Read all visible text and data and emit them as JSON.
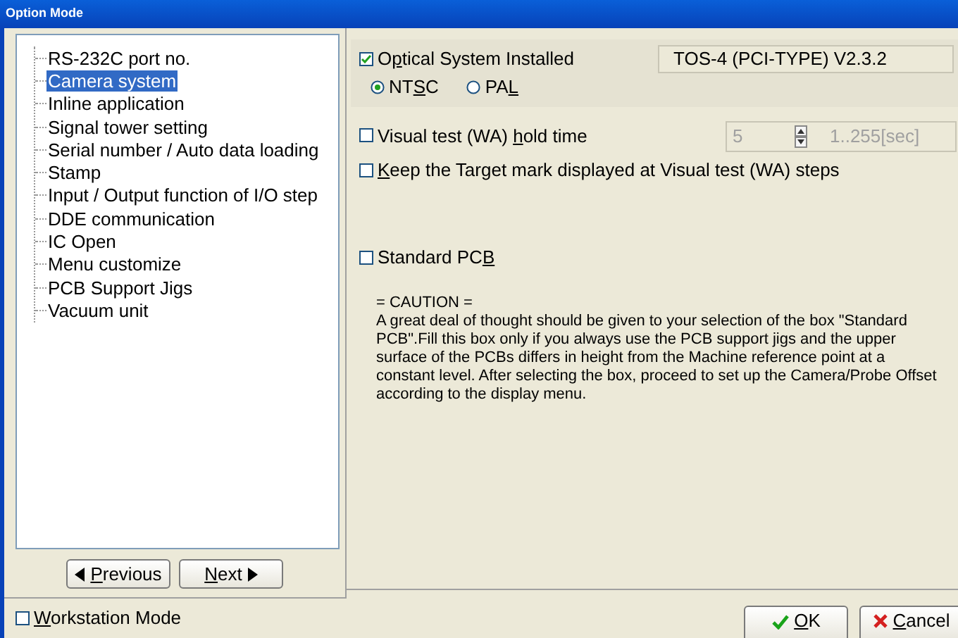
{
  "window": {
    "title": "Option Mode"
  },
  "tree": {
    "items": [
      {
        "label": "RS-232C port no.",
        "selected": false
      },
      {
        "label": "Camera system",
        "selected": true
      },
      {
        "label": "Inline application",
        "selected": false
      },
      {
        "label": "Signal tower setting",
        "selected": false
      },
      {
        "label": "Serial number / Auto data loading",
        "selected": false
      },
      {
        "label": "Stamp",
        "selected": false
      },
      {
        "label": "Input / Output function of I/O step",
        "selected": false
      },
      {
        "label": "DDE communication",
        "selected": false
      },
      {
        "label": "IC Open",
        "selected": false
      },
      {
        "label": "Menu customize",
        "selected": false
      },
      {
        "label": "PCB Support Jigs",
        "selected": false
      },
      {
        "label": "Vacuum unit",
        "selected": false
      }
    ]
  },
  "nav_buttons": [
    {
      "kind": "previous",
      "label": {
        "key": "P",
        "after": "revious"
      }
    },
    {
      "kind": "next",
      "label": {
        "key": "N",
        "after": "ext"
      }
    }
  ],
  "camera": {
    "optical": {
      "label": {
        "before": "O",
        "key": "p",
        "after": "tical System Installed"
      },
      "checked": true
    },
    "version": "TOS-4 (PCI-TYPE) V2.3.2",
    "standards": [
      {
        "label": {
          "before": "NT",
          "key": "S",
          "after": "C"
        },
        "selected": true
      },
      {
        "label": {
          "before": "PA",
          "key": "L"
        },
        "selected": false
      }
    ]
  },
  "hold_time": {
    "label": {
      "before": "Visual test (WA) ",
      "key": "h",
      "after": "old time"
    },
    "checked": false,
    "value": "5",
    "range": "1..255[sec]"
  },
  "keep_target": {
    "label": {
      "key": "K",
      "after": "eep the Target mark displayed at Visual test (WA) steps"
    },
    "checked": false
  },
  "standard_pcb": {
    "label": {
      "before": "Standard PC",
      "key": "B"
    },
    "checked": false
  },
  "caution": {
    "heading": "= CAUTION =",
    "text": "A great deal of thought should be given to your selection of the box \"Standard PCB\".Fill this box only if you always use the PCB support jigs and the upper surface of the PCBs differs in height from the Machine reference point at a constant level. After selecting the box, proceed to set up the Camera/Probe Offset according to the display menu."
  },
  "workstation_mode": {
    "label": {
      "key": "W",
      "after": "orkstation Mode"
    },
    "checked": false
  },
  "dialog_buttons": [
    {
      "kind": "ok",
      "label": {
        "key": "O",
        "after": "K"
      }
    },
    {
      "kind": "cancel",
      "label": {
        "key": "C",
        "after": "ancel"
      }
    }
  ]
}
